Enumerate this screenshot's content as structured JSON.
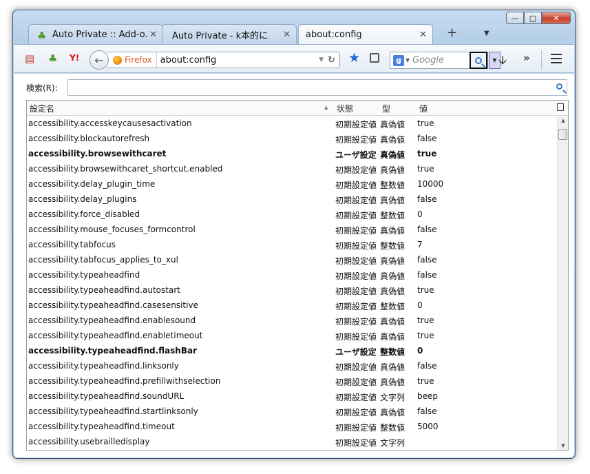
{
  "tabs": [
    {
      "title": "Auto Private :: Add-o...",
      "active": false
    },
    {
      "title": "Auto Private - k本的に無...",
      "active": false
    },
    {
      "title": "about:config",
      "active": true
    }
  ],
  "toolbar": {
    "identity_label": "Firefox",
    "url": "about:config",
    "search_placeholder": "Google",
    "search_engine_letter": "g"
  },
  "filter": {
    "label": "検索(R):",
    "value": ""
  },
  "columns": {
    "name": "設定名",
    "status": "状態",
    "type": "型",
    "value": "値"
  },
  "prefs": [
    {
      "name": "accessibility.accesskeycausesactivation",
      "status": "初期設定値",
      "type": "真偽値",
      "value": "true",
      "modified": false
    },
    {
      "name": "accessibility.blockautorefresh",
      "status": "初期設定値",
      "type": "真偽値",
      "value": "false",
      "modified": false
    },
    {
      "name": "accessibility.browsewithcaret",
      "status": "ユーザ設定",
      "type": "真偽値",
      "value": "true",
      "modified": true
    },
    {
      "name": "accessibility.browsewithcaret_shortcut.enabled",
      "status": "初期設定値",
      "type": "真偽値",
      "value": "true",
      "modified": false
    },
    {
      "name": "accessibility.delay_plugin_time",
      "status": "初期設定値",
      "type": "整数値",
      "value": "10000",
      "modified": false
    },
    {
      "name": "accessibility.delay_plugins",
      "status": "初期設定値",
      "type": "真偽値",
      "value": "false",
      "modified": false
    },
    {
      "name": "accessibility.force_disabled",
      "status": "初期設定値",
      "type": "整数値",
      "value": "0",
      "modified": false
    },
    {
      "name": "accessibility.mouse_focuses_formcontrol",
      "status": "初期設定値",
      "type": "真偽値",
      "value": "false",
      "modified": false
    },
    {
      "name": "accessibility.tabfocus",
      "status": "初期設定値",
      "type": "整数値",
      "value": "7",
      "modified": false
    },
    {
      "name": "accessibility.tabfocus_applies_to_xul",
      "status": "初期設定値",
      "type": "真偽値",
      "value": "false",
      "modified": false
    },
    {
      "name": "accessibility.typeaheadfind",
      "status": "初期設定値",
      "type": "真偽値",
      "value": "false",
      "modified": false
    },
    {
      "name": "accessibility.typeaheadfind.autostart",
      "status": "初期設定値",
      "type": "真偽値",
      "value": "true",
      "modified": false
    },
    {
      "name": "accessibility.typeaheadfind.casesensitive",
      "status": "初期設定値",
      "type": "整数値",
      "value": "0",
      "modified": false
    },
    {
      "name": "accessibility.typeaheadfind.enablesound",
      "status": "初期設定値",
      "type": "真偽値",
      "value": "true",
      "modified": false
    },
    {
      "name": "accessibility.typeaheadfind.enabletimeout",
      "status": "初期設定値",
      "type": "真偽値",
      "value": "true",
      "modified": false
    },
    {
      "name": "accessibility.typeaheadfind.flashBar",
      "status": "ユーザ設定",
      "type": "整数値",
      "value": "0",
      "modified": true
    },
    {
      "name": "accessibility.typeaheadfind.linksonly",
      "status": "初期設定値",
      "type": "真偽値",
      "value": "false",
      "modified": false
    },
    {
      "name": "accessibility.typeaheadfind.prefillwithselection",
      "status": "初期設定値",
      "type": "真偽値",
      "value": "true",
      "modified": false
    },
    {
      "name": "accessibility.typeaheadfind.soundURL",
      "status": "初期設定値",
      "type": "文字列",
      "value": "beep",
      "modified": false
    },
    {
      "name": "accessibility.typeaheadfind.startlinksonly",
      "status": "初期設定値",
      "type": "真偽値",
      "value": "false",
      "modified": false
    },
    {
      "name": "accessibility.typeaheadfind.timeout",
      "status": "初期設定値",
      "type": "整数値",
      "value": "5000",
      "modified": false
    },
    {
      "name": "accessibility.usebrailledisplay",
      "status": "初期設定値",
      "type": "文字列",
      "value": "",
      "modified": false
    }
  ],
  "colors": {
    "titlebar": "#b7d0ea",
    "accent_star": "#1e6fd0",
    "close_button": "#c7402c"
  }
}
